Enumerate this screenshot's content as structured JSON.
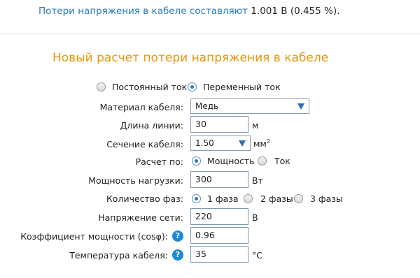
{
  "result": {
    "text": "Потери напряжения в кабеле составляют",
    "value": "1.001 В (0.455 %)."
  },
  "form": {
    "title": "Новый расчет потери напряжения в кабеле",
    "current_type": {
      "options": [
        "Постоянный ток",
        "Переменный ток"
      ],
      "selected": "Переменный ток"
    },
    "material": {
      "label": "Материал кабеля:",
      "value": "Медь"
    },
    "length": {
      "label": "Длина линии:",
      "value": "30",
      "unit": "м"
    },
    "section": {
      "label": "Сечение кабеля:",
      "value": "1.50",
      "unit": "мм",
      "unit_sup": "2"
    },
    "calc_by": {
      "label": "Расчет по:",
      "options": [
        "Мощность",
        "Ток"
      ],
      "selected": "Мощность"
    },
    "power": {
      "label": "Мощность нагрузки:",
      "value": "300",
      "unit": "Вт"
    },
    "phases": {
      "label": "Количество фаз:",
      "options": [
        "1 фаза",
        "2 фазы",
        "3 фазы"
      ],
      "selected": "1 фаза"
    },
    "voltage": {
      "label": "Напряжение сети:",
      "value": "220",
      "unit": "В"
    },
    "power_factor": {
      "label": "Коэффициент мощности (cosφ):",
      "value": "0.96",
      "help": "?"
    },
    "temperature": {
      "label": "Температура кабеля:",
      "value": "35",
      "unit": "°C",
      "help": "?"
    }
  },
  "colors": {
    "result_text": "#2a7bbd",
    "title": "#e8960c",
    "help_icon": "#1a8ad3",
    "radio_dot": "#3576c8",
    "select_arrow": "#2d6db4"
  }
}
